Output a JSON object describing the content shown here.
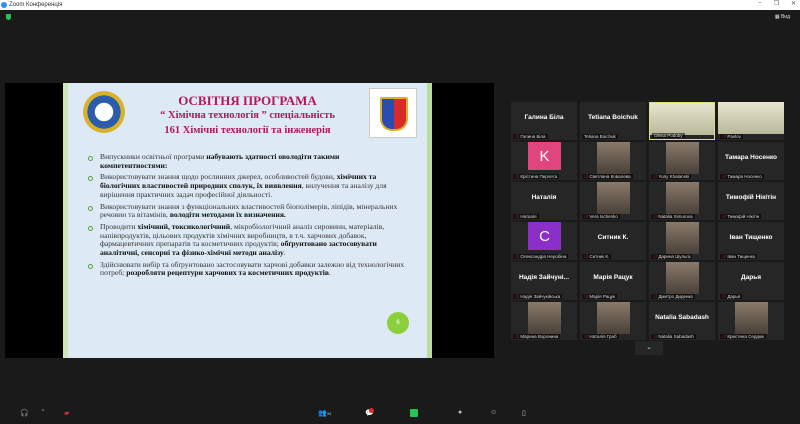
{
  "window": {
    "title": "Zoom Конференція",
    "controls": [
      "–",
      "❐",
      "✕"
    ],
    "view_label": "Вид"
  },
  "slide": {
    "title1": "ОСВІТНЯ ПРОГРАМА",
    "title2": "“ Хімічна технологія ” спеціальність",
    "title3": "161 Хімічні технології та інженерія",
    "bullets": [
      {
        "plain": "Випускники освітньої програми ",
        "bold": "набувають здатності оволодіти такими компетентностями:",
        "rest": ""
      },
      {
        "plain": "Використовувати знання щодо рослинних джерел, особливостей будови, ",
        "bold": "хімічних та біологічних властивостей природних сполук, їх виявлення",
        "rest": ", вилучення та аналізу для вирішення практичних задач професійної діяльності."
      },
      {
        "plain": "Використовувати знання з функціональних властивостей біополімерів, ліпідів, мінеральних речовин та вітамінів, ",
        "bold": "володіти методами їх визначення.",
        "rest": ""
      },
      {
        "plain": "Проводити ",
        "bold": "хімічний, токсикологічний",
        "rest": ", мікробіологічний аналіз сировини, матеріалів, напівпродуктів, цільових продуктів хімічних виробництв, в т.ч. харчових добавок, фармацевтичних препаратів та косметичних продуктів; ",
        "bold2": "обґрунтовано застосовувати аналітичні, сенсорні та фізико-хімічні методи аналізу",
        "rest2": "."
      },
      {
        "plain": "Здійснювати вибір та обґрунтовано застосовувати харчові добавки залежно від технологічних потреб; ",
        "bold": "розробляти рецептури харчових та косметичних продуктів",
        "rest": "."
      }
    ],
    "page_number": "6"
  },
  "participants": [
    {
      "type": "name",
      "name": "Галина Біла",
      "label": "Галина Біла"
    },
    {
      "type": "name",
      "name": "Tetiana Boichuk",
      "label": "Tetiana Boichuk",
      "nomic": true
    },
    {
      "type": "video",
      "label": "Olena Podoby",
      "active": true,
      "wide": true,
      "nomic": true
    },
    {
      "type": "video",
      "label": "Pavlov",
      "wide": true
    },
    {
      "type": "avatar",
      "initial": "K",
      "color": "#e0457b",
      "label": "Крістина Перлета"
    },
    {
      "type": "video",
      "label": "Светлана Ковалева"
    },
    {
      "type": "video",
      "label": "Yuriy Khalanski"
    },
    {
      "type": "name",
      "name": "Тамара Носенко",
      "label": "Тамара Носенко"
    },
    {
      "type": "name",
      "name": "Наталія",
      "label": "Наталія"
    },
    {
      "type": "video",
      "label": "Vera Ischenko"
    },
    {
      "type": "video",
      "label": "Natalia Simurova"
    },
    {
      "type": "name",
      "name": "Тимофій Нікітін",
      "label": "Тимофій Нікітін"
    },
    {
      "type": "avatar",
      "initial": "C",
      "color": "#8b2fc9",
      "label": "Олександра Неробіна"
    },
    {
      "type": "name",
      "name": "Ситник К.",
      "label": "Ситник К."
    },
    {
      "type": "video",
      "label": "Дарина Шульга"
    },
    {
      "type": "name",
      "name": "Іван Тищенко",
      "label": "Іван Тищенко"
    },
    {
      "type": "name",
      "name": "Надія Зайчуні...",
      "label": "Надія Зайчуківська"
    },
    {
      "type": "name",
      "name": "Марія Рацук",
      "label": "Марія Рацук"
    },
    {
      "type": "video",
      "label": "Дмитро Диденко"
    },
    {
      "type": "name",
      "name": "Дарья",
      "label": "Дарья"
    },
    {
      "type": "video",
      "label": "Марина Воронина"
    },
    {
      "type": "video",
      "label": "Наталія Граб"
    },
    {
      "type": "name",
      "name": "Natalia Sabadash",
      "label": "Natalia Sabadash"
    },
    {
      "type": "video",
      "label": "Кристина Сердюк"
    }
  ],
  "toolbar": {
    "participants_count": "35",
    "chevron": "⌄"
  }
}
